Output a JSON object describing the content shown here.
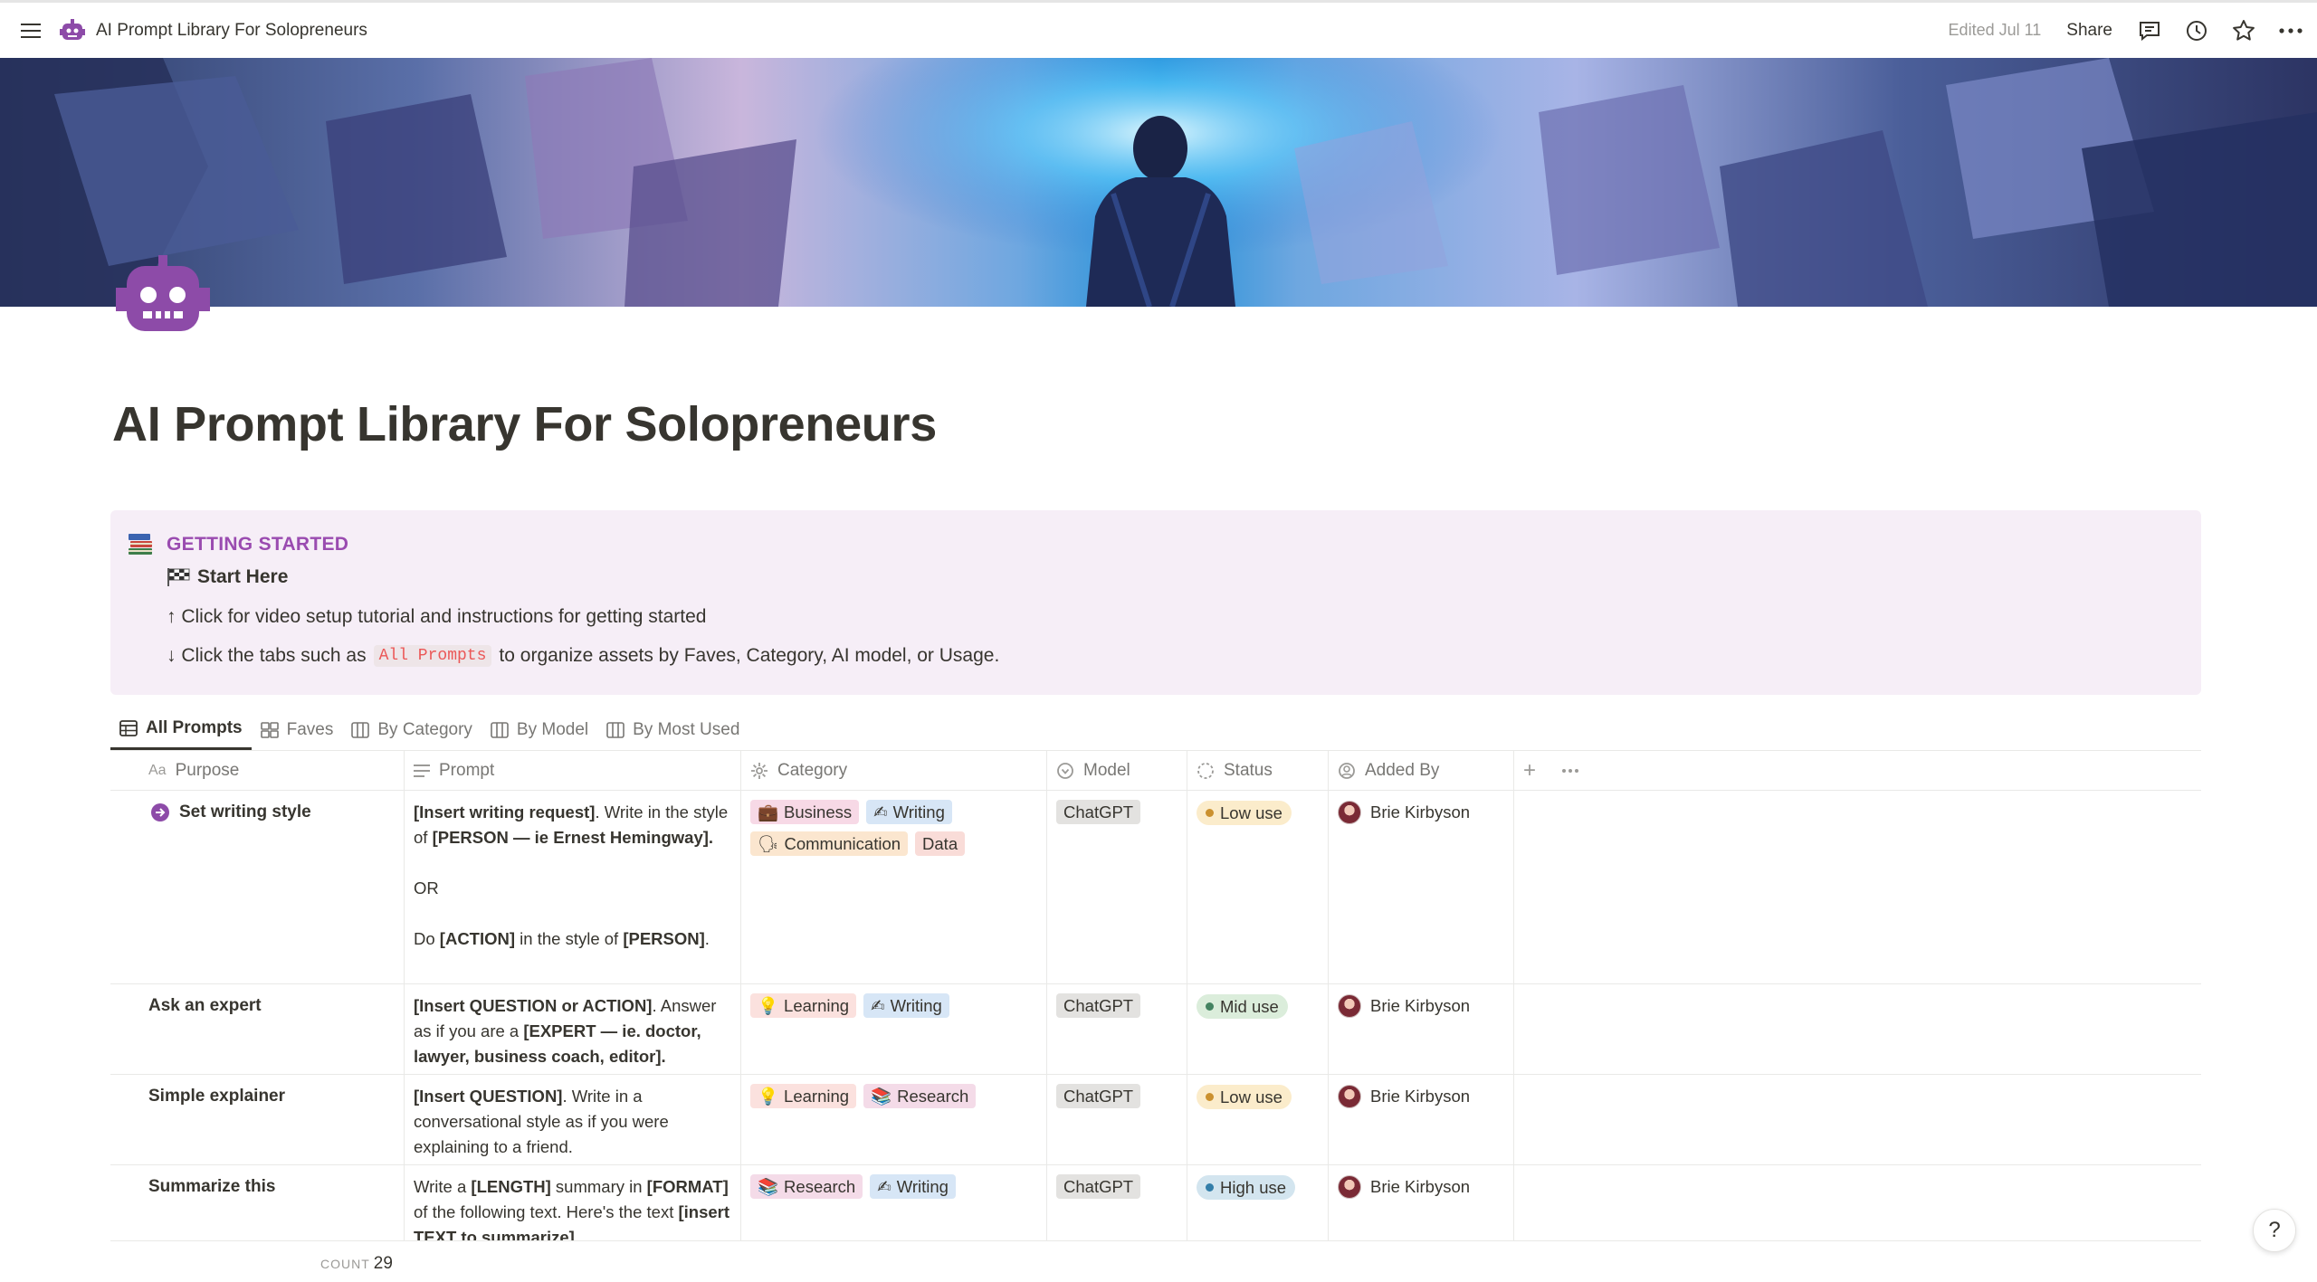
{
  "topbar": {
    "breadcrumb": "AI Prompt Library For Solopreneurs",
    "edited": "Edited Jul 11",
    "share": "Share",
    "icons": [
      "menu-icon",
      "robot-icon",
      "comment-icon",
      "history-icon",
      "star-icon",
      "more-icon"
    ]
  },
  "page": {
    "title": "AI Prompt Library For Solopreneurs",
    "emoji": "robot-icon"
  },
  "callout": {
    "title": "GETTING STARTED",
    "start_here": "Start Here",
    "line1": "↑ Click for video setup tutorial and instructions for getting started",
    "line2_prefix": "↓ Click the tabs such as",
    "line2_code": "All Prompts",
    "line2_suffix": "to organize assets by Faves, Category, AI model, or Usage."
  },
  "tabs": [
    "All Prompts",
    "Faves",
    "By Category",
    "By Model",
    "By Most Used"
  ],
  "columns": [
    "Purpose",
    "Prompt",
    "Category",
    "Model",
    "Status",
    "Added By"
  ],
  "rows": [
    {
      "purpose": "Set writing style",
      "categories": [
        "Business",
        "Writing",
        "Communication",
        "Data"
      ],
      "model": "ChatGPT",
      "status": "Low use",
      "added_by": "Brie Kirbyson"
    },
    {
      "purpose": "Ask an expert",
      "categories": [
        "Learning",
        "Writing"
      ],
      "model": "ChatGPT",
      "status": "Mid use",
      "added_by": "Brie Kirbyson"
    },
    {
      "purpose": "Simple explainer",
      "categories": [
        "Learning",
        "Research"
      ],
      "model": "ChatGPT",
      "status": "Low use",
      "added_by": "Brie Kirbyson"
    },
    {
      "purpose": "Summarize this",
      "categories": [
        "Research",
        "Writing"
      ],
      "model": "ChatGPT",
      "status": "High use",
      "added_by": "Brie Kirbyson"
    }
  ],
  "prompts": {
    "r1": {
      "p1_b1": "[Insert writing request]",
      "p1_t1": ". Write in the style of ",
      "p1_b2": "[PERSON — ie Ernest Hemingway].",
      "p2": "OR",
      "p3_t1": "Do ",
      "p3_b1": "[ACTION]",
      "p3_t2": " in the style of ",
      "p3_b2": "[PERSON]",
      "p3_t3": "."
    },
    "r2": {
      "b1": "[Insert QUESTION or ACTION]",
      "t1": ". Answer as if you are a ",
      "b2": "[EXPERT — ie. doctor, lawyer, business coach, editor]."
    },
    "r3": {
      "b1": "[Insert QUESTION]",
      "t1": ". Write in a conversational style as if you were explaining to a friend."
    },
    "r4": {
      "t1": "Write a ",
      "b1": "[LENGTH]",
      "t2": " summary in ",
      "b2": "[FORMAT]",
      "t3": " of the following text. Here's the text ",
      "b3": "[insert TEXT to summarize]"
    }
  },
  "footer": {
    "count_label": "COUNT",
    "count_value": "29",
    "help": "?"
  },
  "colors": {
    "accent_purple": "#9a4bb0",
    "callout_bg": "#f6eef7"
  }
}
